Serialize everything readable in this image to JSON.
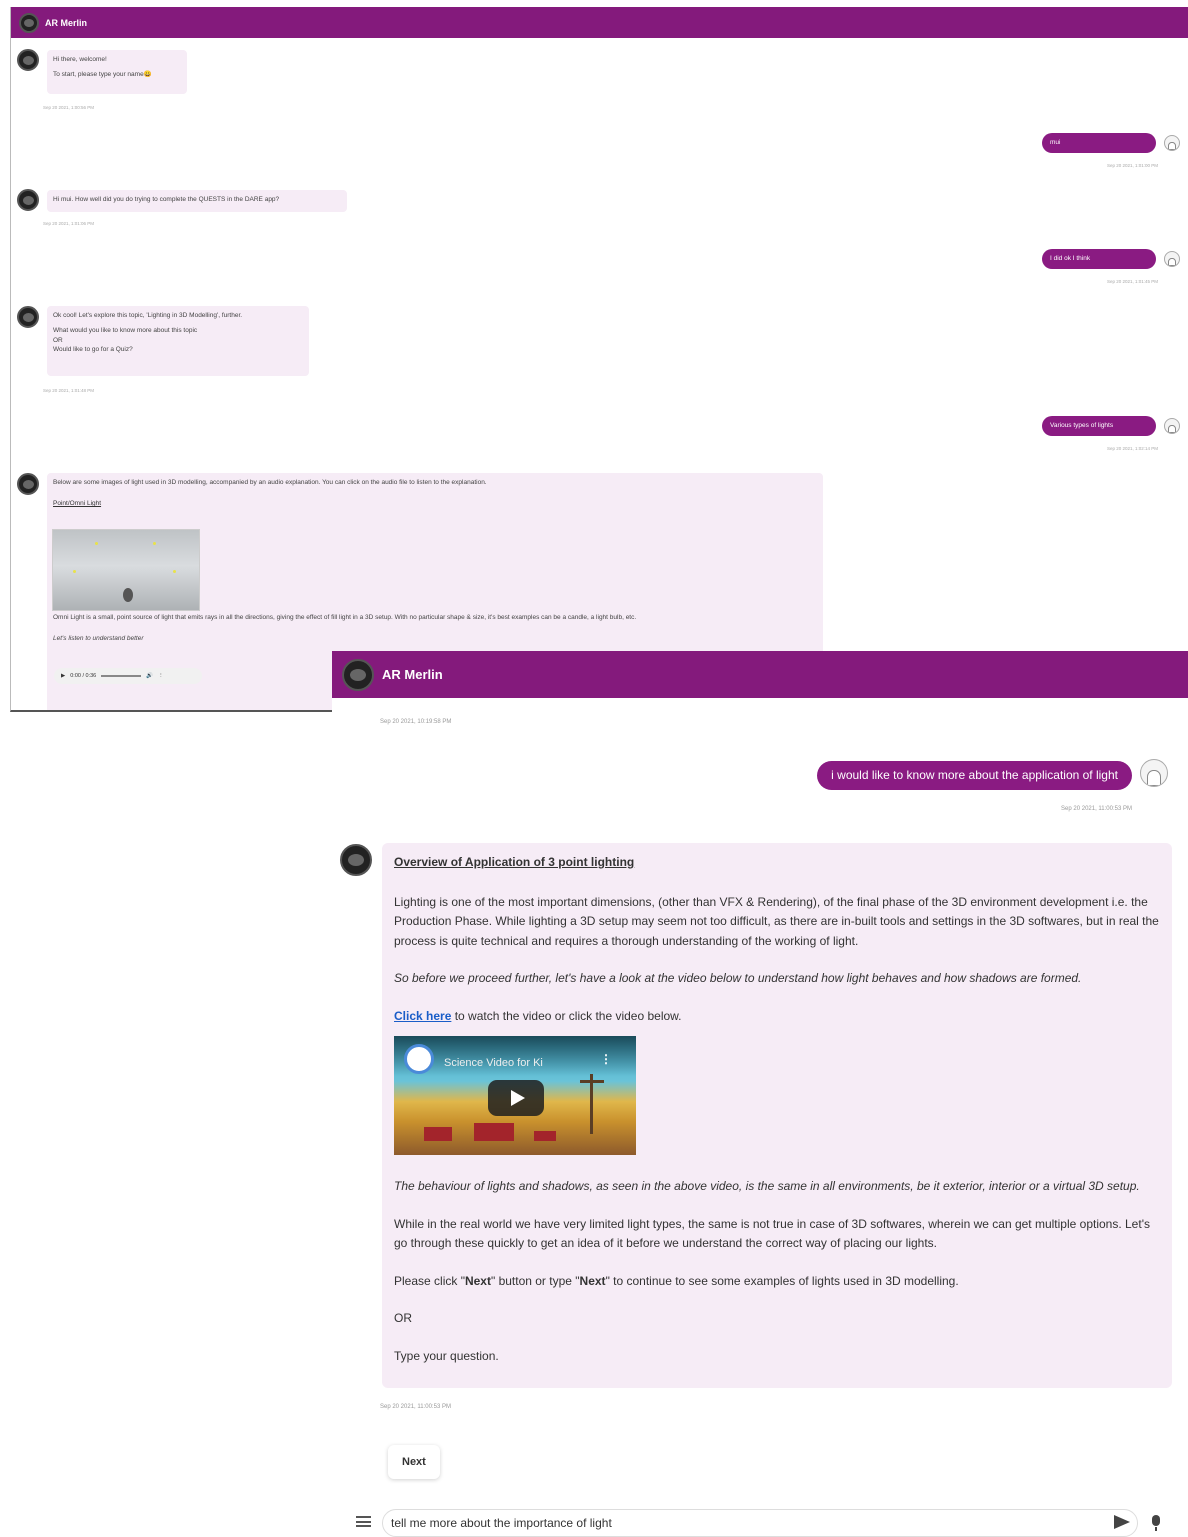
{
  "app": {
    "title": "AR Merlin"
  },
  "panel1": {
    "header_title": "AR Merlin",
    "messages": [
      {
        "type": "bot",
        "lines": [
          "Hi there, welcome!",
          "To start, please type your name😀"
        ],
        "timestamp": "Sep 20 2021, 1:00:56 PM"
      },
      {
        "type": "user",
        "text": "mui",
        "timestamp": "Sep 20 2021, 1:01:00 PM"
      },
      {
        "type": "bot",
        "lines": [
          "Hi mui. How well did you do trying to complete the QUESTS in the DARE app?"
        ],
        "timestamp": "Sep 20 2021, 1:01:06 PM"
      },
      {
        "type": "user",
        "text": "I did ok I think",
        "timestamp": "Sep 20 2021, 1:01:45 PM"
      },
      {
        "type": "bot",
        "lines": [
          "Ok cool! Let's explore this topic, 'Lighting in 3D Modelling', further.",
          "What would you like to know more about this topic",
          "OR",
          "Would like to go for a Quiz?"
        ],
        "timestamp": "Sep 20 2021, 1:01:48 PM"
      },
      {
        "type": "user",
        "text": "Various types of lights",
        "timestamp": "Sep 20 2021, 1:02:14 PM"
      }
    ],
    "lights_message": {
      "intro": "Below are some images of light used in 3D modelling, accompanied by an audio explanation. You can click on the audio file to listen to the explanation.",
      "link": "Point/Omni Light",
      "description": "Omni Light is a small, point source of light that emits rays in all the directions, giving the effect of fill light in a 3D setup. With no particular shape & size, it's best examples can be a candle, a light bulb, etc.",
      "audio_prompt": "Let's listen to understand better",
      "audio_time": "0:00 / 0:36"
    }
  },
  "panel2": {
    "header_title": "AR Merlin",
    "prev_timestamp": "Sep 20 2021, 10:19:58 PM",
    "user_message": "i would like to know more about the application of light",
    "user_timestamp": "Sep 20 2021, 11:00:53 PM",
    "bot": {
      "heading": "Overview of Application of 3 point lighting",
      "para1": "Lighting is one of the most important dimensions, (other than VFX & Rendering), of the final phase of the 3D environment development i.e. the Production Phase. While lighting a 3D setup may seem not too difficult, as there are in-built tools and settings in the 3D softwares, but in real the process is quite technical and requires a thorough understanding of the working of light.",
      "para2": "So before we proceed further, let's have a look at the video below to understand how light behaves and how shadows are formed.",
      "link_text": "Click here",
      "link_rest": " to watch the video or click the video below.",
      "video_title": "Science Video for Ki",
      "para3": "The behaviour of lights and shadows, as seen in the above video, is the same in all environments, be it exterior, interior or a virtual 3D setup.",
      "para4": "While in the real world we have very limited light types, the same is not true in case of 3D softwares, wherein we can get multiple options. Let's go through these quickly to get an idea of it before we understand the correct way of placing our lights.",
      "para5_a": "Please click \"",
      "para5_next1": "Next",
      "para5_b": "\" button or type \"",
      "para5_next2": "Next",
      "para5_c": "\" to continue to see some examples of lights used in 3D modelling.",
      "para6": "OR",
      "para7": "Type your question.",
      "timestamp": "Sep 20 2021, 11:00:53 PM"
    },
    "next_button": "Next",
    "input_value": "tell me more about the importance of light"
  },
  "colors": {
    "brand": "#841a7c",
    "user_bubble": "#8a1b82",
    "bot_bubble": "#f6ecf6",
    "link": "#1a5dc8"
  }
}
